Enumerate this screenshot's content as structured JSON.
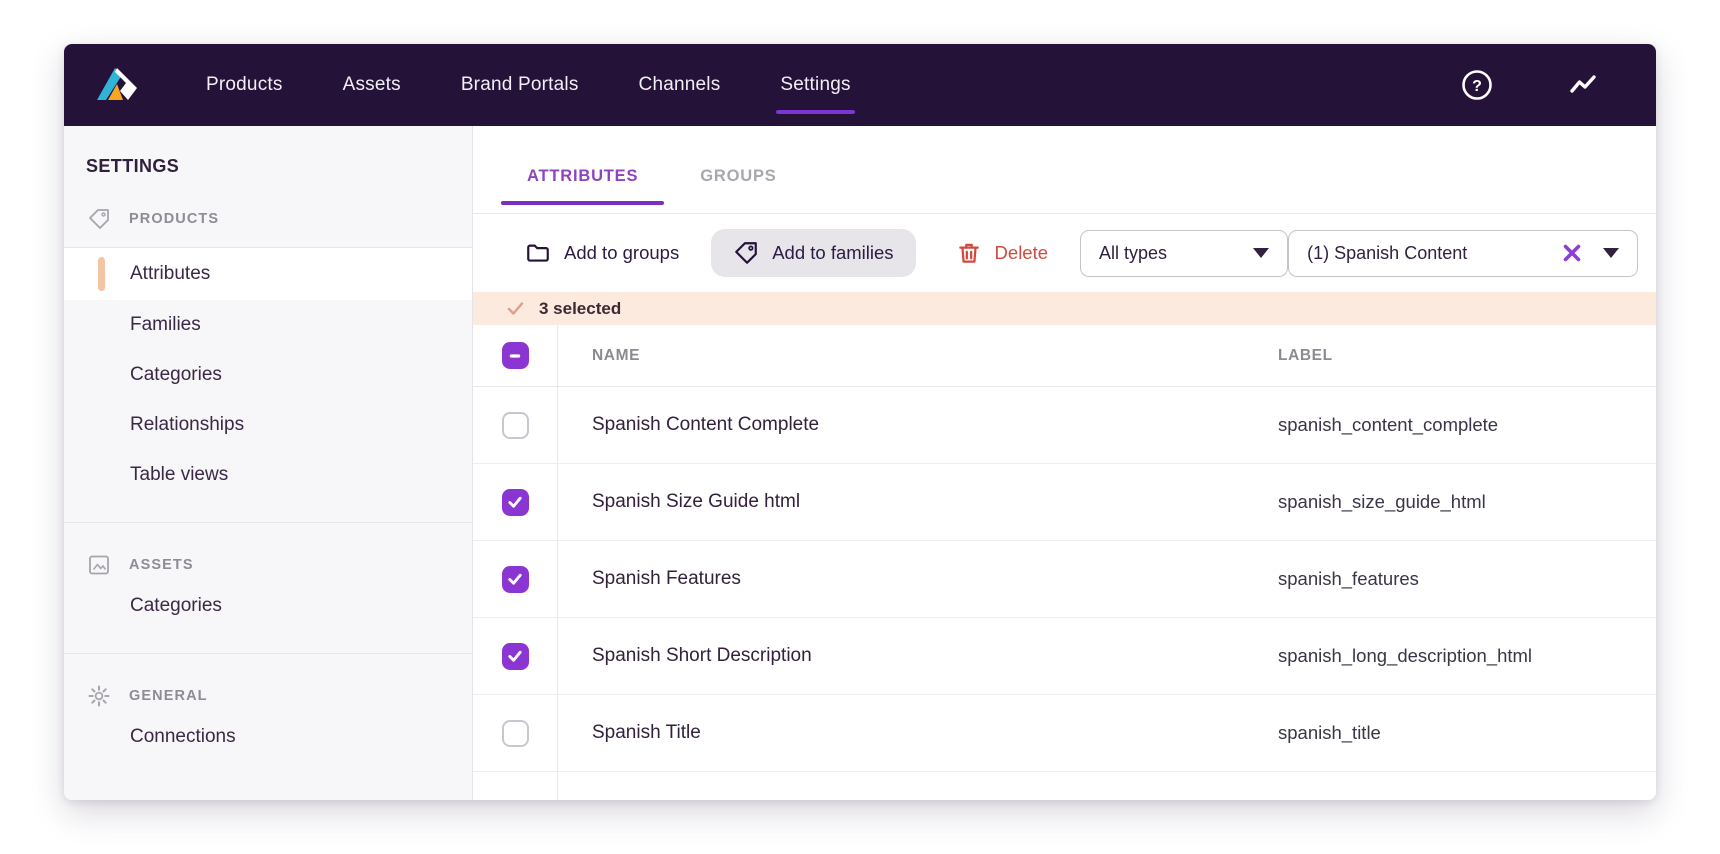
{
  "colors": {
    "nav_background": "#241239",
    "accent_purple": "#8b36d3",
    "tab_purple": "#8c44c1",
    "underline_purple": "#7a2fc2",
    "delete_red": "#d24a3f",
    "peach_accent": "#f3c5a5",
    "selected_banner_bg": "#fdeade",
    "sidebar_bg": "#f7f6f8",
    "logo_teal": "#2fb4d8",
    "logo_orange": "#f5a623"
  },
  "topnav": {
    "logo": "akeneo-logo",
    "items": [
      {
        "label": "Products",
        "active": false
      },
      {
        "label": "Assets",
        "active": false
      },
      {
        "label": "Brand Portals",
        "active": false
      },
      {
        "label": "Channels",
        "active": false
      },
      {
        "label": "Settings",
        "active": true
      }
    ],
    "icons": [
      "help-icon",
      "activity-icon"
    ]
  },
  "sidebar": {
    "title": "SETTINGS",
    "sections": [
      {
        "label": "PRODUCTS",
        "icon": "tag-icon",
        "items": [
          {
            "label": "Attributes",
            "active": true
          },
          {
            "label": "Families",
            "active": false
          },
          {
            "label": "Categories",
            "active": false
          },
          {
            "label": "Relationships",
            "active": false
          },
          {
            "label": "Table views",
            "active": false
          }
        ]
      },
      {
        "label": "ASSETS",
        "icon": "image-icon",
        "items": [
          {
            "label": "Categories",
            "active": false
          }
        ]
      },
      {
        "label": "GENERAL",
        "icon": "gear-icon",
        "items": [
          {
            "label": "Connections",
            "active": false
          }
        ]
      }
    ]
  },
  "main": {
    "tabs": [
      {
        "label": "ATTRIBUTES",
        "active": true
      },
      {
        "label": "GROUPS",
        "active": false
      }
    ],
    "toolbar": {
      "add_to_groups": "Add to groups",
      "add_to_families": "Add to families",
      "delete": "Delete",
      "type_filter": {
        "value": "All types"
      },
      "group_filter": {
        "value": "(1) Spanish Content"
      }
    },
    "selection": {
      "count_text": "3 selected"
    },
    "table": {
      "columns": [
        "NAME",
        "LABEL"
      ],
      "header_checkbox_state": "indeterminate",
      "rows": [
        {
          "name": "Spanish Content Complete",
          "label": "spanish_content_complete",
          "checked": false
        },
        {
          "name": "Spanish Size Guide html",
          "label": "spanish_size_guide_html",
          "checked": true
        },
        {
          "name": "Spanish Features",
          "label": "spanish_features",
          "checked": true
        },
        {
          "name": "Spanish Short Description",
          "label": "spanish_long_description_html",
          "checked": true
        },
        {
          "name": "Spanish Title",
          "label": "spanish_title",
          "checked": false
        }
      ]
    }
  }
}
